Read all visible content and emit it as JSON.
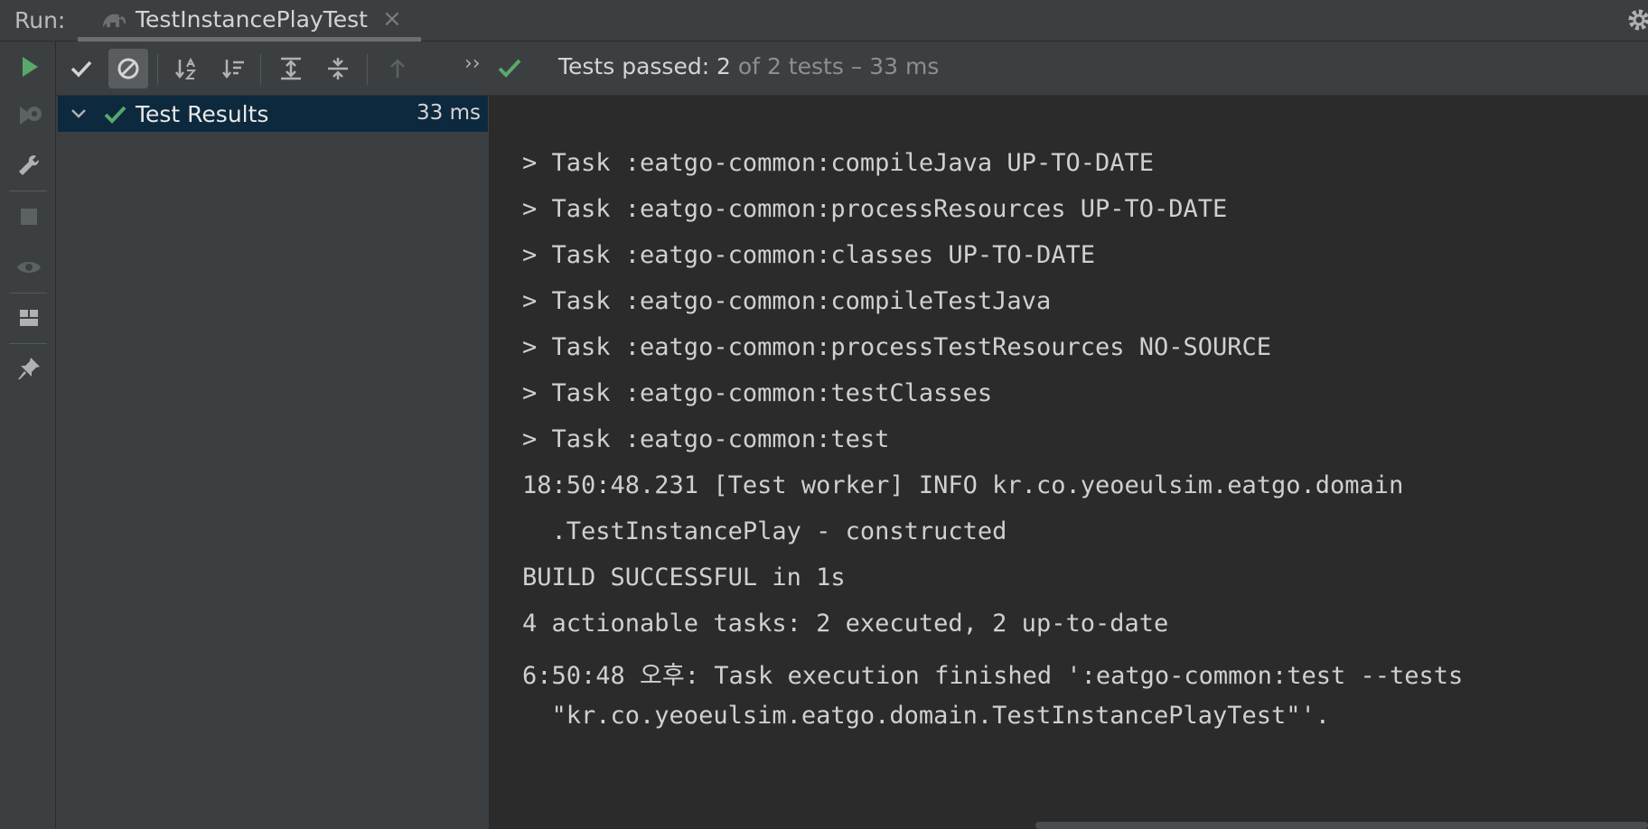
{
  "header": {
    "run_label": "Run:",
    "tab_title": "TestInstancePlayTest",
    "tab_close": "×"
  },
  "toolbar": {
    "status_pass": "Tests passed: 2",
    "status_rest": " of 2 tests – 33 ms",
    "more": "››"
  },
  "tree": {
    "root_label": "Test Results",
    "root_time": "33 ms"
  },
  "console": {
    "lines": [
      "> Task :eatgo-common:compileJava UP-TO-DATE",
      "> Task :eatgo-common:processResources UP-TO-DATE",
      "> Task :eatgo-common:classes UP-TO-DATE",
      "> Task :eatgo-common:compileTestJava",
      "> Task :eatgo-common:processTestResources NO-SOURCE",
      "> Task :eatgo-common:testClasses",
      "> Task :eatgo-common:test",
      "18:50:48.231 [Test worker] INFO kr.co.yeoeulsim.eatgo.domain",
      "  .TestInstancePlay - constructed",
      "BUILD SUCCESSFUL in 1s",
      "4 actionable tasks: 2 executed, 2 up-to-date",
      "6:50:48 오후: Task execution finished ':eatgo-common:test --tests",
      "  \"kr.co.yeoeulsim.eatgo.domain.TestInstancePlayTest\"'."
    ]
  },
  "colors": {
    "accent_green": "#59a869",
    "selection": "#0d293e",
    "panel": "#3c3f41",
    "console_bg": "#2b2b2b"
  },
  "icons": {
    "tab": "gradle-elephant-icon",
    "settings": "gear-icon",
    "rerun": "play-icon",
    "rerun_failed": "rerun-failed-icon",
    "build": "wrench-icon",
    "stop": "stop-icon",
    "show": "eye-icon",
    "layout": "layout-icon",
    "pin": "pin-icon"
  }
}
